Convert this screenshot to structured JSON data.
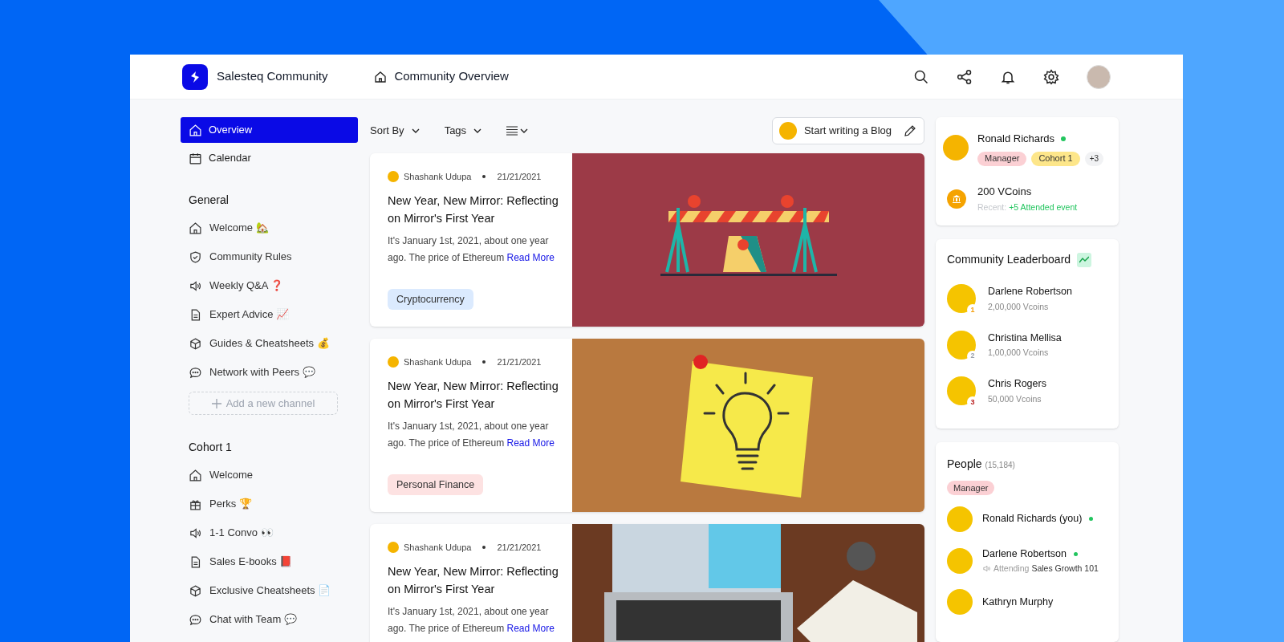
{
  "header": {
    "app_name": "Salesteq Community",
    "page_title": "Community Overview"
  },
  "sidebar": {
    "nav": [
      {
        "label": "Overview",
        "kind": "home",
        "selected": true
      },
      {
        "label": "Calendar",
        "kind": "calendar",
        "selected": false
      }
    ],
    "sections": [
      {
        "title": "General",
        "items": [
          {
            "label": "Welcome",
            "emoji": "🏡",
            "kind": "home"
          },
          {
            "label": "Community Rules",
            "kind": "shield"
          },
          {
            "label": "Weekly Q&A",
            "emoji": "❓",
            "kind": "speaker"
          },
          {
            "label": "Expert Advice",
            "emoji": "📈",
            "kind": "doc"
          },
          {
            "label": "Guides & Cheatsheets",
            "emoji": "💰",
            "kind": "cube"
          },
          {
            "label": "Network with Peers",
            "emoji": "💬",
            "kind": "chat"
          }
        ],
        "add_label": "Add a new channel"
      },
      {
        "title": "Cohort 1",
        "items": [
          {
            "label": "Welcome",
            "kind": "home"
          },
          {
            "label": "Perks",
            "emoji": "🏆",
            "kind": "gift"
          },
          {
            "label": "1-1 Convo",
            "emoji": "👀",
            "kind": "speaker"
          },
          {
            "label": "Sales E-books",
            "emoji": "📕",
            "kind": "doc"
          },
          {
            "label": "Exclusive Cheatsheets",
            "emoji": "📄",
            "kind": "cube"
          },
          {
            "label": "Chat with Team",
            "emoji": "💬",
            "kind": "chat"
          }
        ]
      }
    ]
  },
  "toolbar": {
    "sort": "Sort By",
    "tags": "Tags",
    "write": "Start writing a Blog"
  },
  "posts": [
    {
      "author": "Shashank Udupa",
      "date": "21/21/2021",
      "title": "New Year, New Mirror: Reflecting on Mirror's First Year",
      "excerpt": "It's January 1st, 2021, about one year ago. The price of Ethereum",
      "read_more": "Read More",
      "tag": {
        "label": "Cryptocurrency",
        "color": "#dbeafe"
      },
      "kind": "barrier"
    },
    {
      "author": "Shashank Udupa",
      "date": "21/21/2021",
      "title": "New Year, New Mirror: Reflecting on Mirror's First Year",
      "excerpt": "It's January 1st, 2021, about one year ago. The price of Ethereum",
      "read_more": "Read More",
      "tag": {
        "label": "Personal Finance",
        "color": "#fde2e2"
      },
      "kind": "corkboard"
    },
    {
      "author": "Shashank Udupa",
      "date": "21/21/2021",
      "title": "New Year, New Mirror: Reflecting on Mirror's First Year",
      "excerpt": "It's January 1st, 2021, about one year ago. The price of Ethereum",
      "read_more": "Read More",
      "kind": "desk"
    }
  ],
  "profile": {
    "name": "Ronald Richards",
    "online": true,
    "tags": [
      {
        "label": "Manager",
        "color": "#fbd0d4"
      },
      {
        "label": "Cohort 1",
        "color": "#fde68a"
      }
    ],
    "more": "+3",
    "coins": "200 VCoins",
    "recent_label": "Recent:",
    "recent_value": "+5 Attended event"
  },
  "leaderboard": {
    "title": "Community Leaderboard",
    "entries": [
      {
        "name": "Darlene Robertson",
        "coins": "2,00,000 Vcoins",
        "rank": "1",
        "color": "#f59e0b"
      },
      {
        "name": "Christina Mellisa",
        "coins": "1,00,000 Vcoins",
        "rank": "2",
        "color": "#9ca3af"
      },
      {
        "name": "Chris Rogers",
        "coins": "50,000 Vcoins",
        "rank": "3",
        "color": "#b91c1c"
      }
    ]
  },
  "people": {
    "title": "People",
    "count": "(15,184)",
    "filter": "Manager",
    "members": [
      {
        "name": "Ronald Richards (you)",
        "online": true
      },
      {
        "name": "Darlene Robertson",
        "online": true,
        "activity_label": "Attending",
        "activity_value": "Sales Growth 101"
      },
      {
        "name": "Kathryn Murphy",
        "online": false
      }
    ]
  }
}
